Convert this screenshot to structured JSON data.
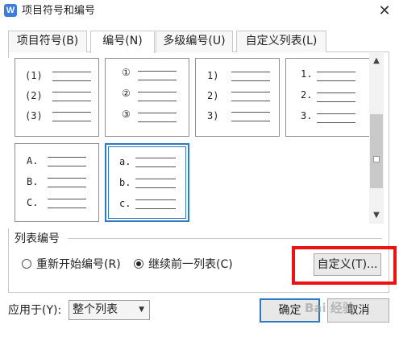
{
  "window": {
    "title": "项目符号和编号",
    "app_icon_letter": "W",
    "close_glyph": "✕"
  },
  "tabs": [
    {
      "label": "项目符号(B)"
    },
    {
      "label": "编号(N)"
    },
    {
      "label": "多级编号(U)"
    },
    {
      "label": "自定义列表(L)"
    }
  ],
  "active_tab": "编号(N)",
  "numbering_styles": [
    {
      "markers": [
        "(1)",
        "(2)",
        "(3)"
      ]
    },
    {
      "markers": [
        "①",
        "②",
        "③"
      ]
    },
    {
      "markers": [
        "1)",
        "2)",
        "3)"
      ]
    },
    {
      "markers": [
        "1.",
        "2.",
        "3."
      ]
    },
    {
      "markers": [
        "A.",
        "B.",
        "C."
      ]
    },
    {
      "markers": [
        "a.",
        "b.",
        "c."
      ],
      "selected": true
    }
  ],
  "scrollbar": {
    "up": "▲",
    "down": "▼"
  },
  "list_numbering": {
    "group_label": "列表编号",
    "restart_label": "重新开始编号(R)",
    "continue_label": "继续前一列表(C)",
    "selected_option": "继续前一列表(C)",
    "customize_button": "自定义(T)..."
  },
  "apply_to": {
    "label": "应用于(Y):",
    "value": "整个列表"
  },
  "buttons": {
    "ok": "确定",
    "cancel": "取消"
  },
  "watermark": "Bai 经验",
  "colors": {
    "accent": "#2f79c3",
    "highlight_box": "#ee1111"
  }
}
